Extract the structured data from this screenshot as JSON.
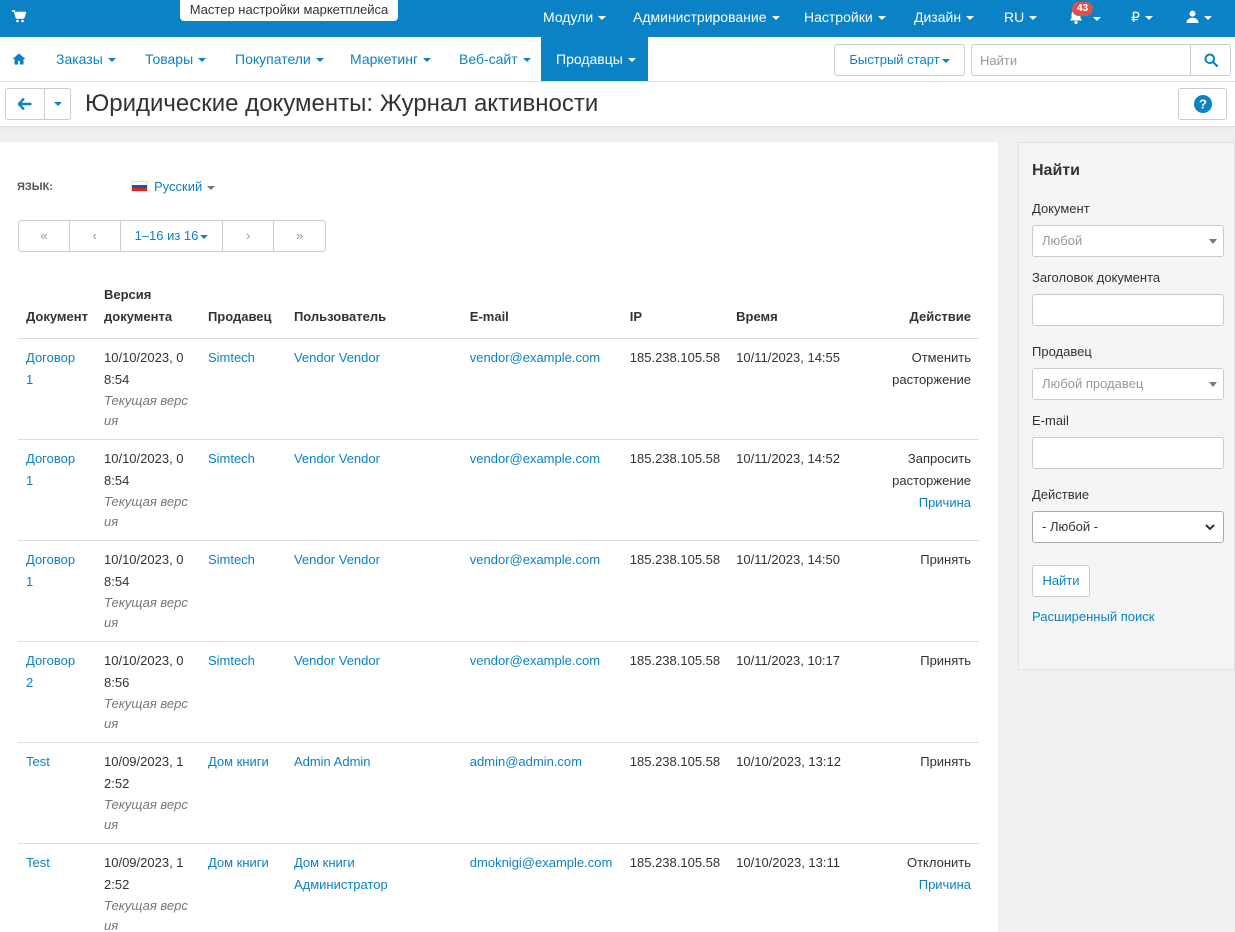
{
  "topbar": {
    "wizard_label": "Мастер настройки маркетплейса",
    "menus": [
      "Модули",
      "Администрирование",
      "Настройки",
      "Дизайн",
      "RU"
    ],
    "notifications_count": "43",
    "currency": "₽",
    "icons": [
      "cart-icon",
      "bell-icon",
      "user-icon"
    ]
  },
  "nav": {
    "items": [
      "Заказы",
      "Товары",
      "Покупатели",
      "Маркетинг",
      "Веб-сайт",
      "Продавцы"
    ],
    "active": "Продавцы",
    "quick_start": "Быстрый старт",
    "search_placeholder": "Найти"
  },
  "page": {
    "title": "Юридические документы: Журнал активности"
  },
  "language": {
    "label": "ЯЗЫК:",
    "value": "Русский"
  },
  "pager": {
    "first": "«",
    "prev": "‹",
    "current": "1–16 из 16",
    "next": "›",
    "last": "»"
  },
  "table": {
    "headers": {
      "document": "Документ",
      "version": "Версия документа",
      "vendor": "Продавец",
      "user": "Пользователь",
      "email": "E-mail",
      "ip": "IP",
      "time": "Время",
      "action": "Действие"
    },
    "rows": [
      {
        "document": "Договор 1",
        "version": "10/10/2023, 08:54",
        "version_note": "Текущая версия",
        "vendor": "Simtech",
        "user": "Vendor Vendor",
        "email": "vendor@example.com",
        "ip": "185.238.105.58",
        "time": "10/11/2023, 14:55",
        "action": "Отменить расторжение",
        "reason": ""
      },
      {
        "document": "Договор 1",
        "version": "10/10/2023, 08:54",
        "version_note": "Текущая версия",
        "vendor": "Simtech",
        "user": "Vendor Vendor",
        "email": "vendor@example.com",
        "ip": "185.238.105.58",
        "time": "10/11/2023, 14:52",
        "action": "Запросить расторжение",
        "reason": "Причина"
      },
      {
        "document": "Договор 1",
        "version": "10/10/2023, 08:54",
        "version_note": "Текущая версия",
        "vendor": "Simtech",
        "user": "Vendor Vendor",
        "email": "vendor@example.com",
        "ip": "185.238.105.58",
        "time": "10/11/2023, 14:50",
        "action": "Принять",
        "reason": ""
      },
      {
        "document": "Договор 2",
        "version": "10/10/2023, 08:56",
        "version_note": "Текущая версия",
        "vendor": "Simtech",
        "user": "Vendor Vendor",
        "email": "vendor@example.com",
        "ip": "185.238.105.58",
        "time": "10/11/2023, 10:17",
        "action": "Принять",
        "reason": ""
      },
      {
        "document": "Test",
        "version": "10/09/2023, 12:52",
        "version_note": "Текущая версия",
        "vendor": "Дом книги",
        "user": "Admin Admin",
        "email": "admin@admin.com",
        "ip": "185.238.105.58",
        "time": "10/10/2023, 13:12",
        "action": "Принять",
        "reason": ""
      },
      {
        "document": "Test",
        "version": "10/09/2023, 12:52",
        "version_note": "Текущая версия",
        "vendor": "Дом книги",
        "user": "Дом книги Администратор",
        "email": "dmoknigi@example.com",
        "ip": "185.238.105.58",
        "time": "10/10/2023, 13:11",
        "action": "Отклонить",
        "reason": "Причина"
      }
    ]
  },
  "sidebar": {
    "title": "Найти",
    "document_label": "Документ",
    "document_value": "Любой",
    "doc_title_label": "Заголовок документа",
    "vendor_label": "Продавец",
    "vendor_value": "Любой продавец",
    "email_label": "E-mail",
    "action_label": "Действие",
    "action_value": "- Любой -",
    "search_button": "Найти",
    "advanced_link": "Расширенный поиск"
  },
  "colors": {
    "brand": "#0b82c6",
    "badge": "#d9534f"
  }
}
